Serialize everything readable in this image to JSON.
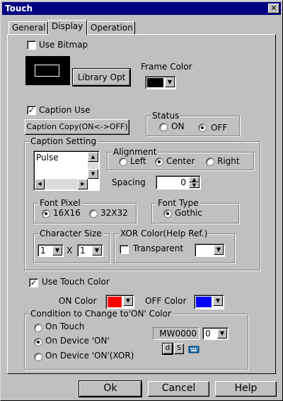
{
  "window": {
    "title": "Touch",
    "close_glyph": "✕"
  },
  "tabs": [
    {
      "label": "General",
      "active": false
    },
    {
      "label": "Display",
      "active": true
    },
    {
      "label": "Operation",
      "active": false
    }
  ],
  "bitmap": {
    "use_label": "Use Bitmap",
    "checked": false,
    "library_button": "Library Opt"
  },
  "frame_color": {
    "label": "Frame Color",
    "color": "#000000"
  },
  "caption": {
    "use_label": "Caption Use",
    "checked": true,
    "check_glyph": "✓",
    "copy_button": "Caption Copy(ON<->OFF)"
  },
  "status": {
    "title": "Status",
    "on_label": "ON",
    "off_label": "OFF",
    "selected": "OFF"
  },
  "caption_setting": {
    "title": "Caption Setting",
    "text_value": "Pulse",
    "alignment": {
      "title": "Alignment",
      "left": "Left",
      "center": "Center",
      "right": "Right",
      "selected": "Center"
    },
    "spacing": {
      "label": "Spacing",
      "value": "0"
    },
    "font_pixel": {
      "title": "Font Pixel",
      "opt1": "16X16",
      "opt2": "32X32",
      "selected": "16X16"
    },
    "font_type": {
      "title": "Font Type",
      "opt1": "Gothic",
      "selected": "Gothic"
    },
    "character_size": {
      "title": "Character Size",
      "width": "1",
      "height": "1",
      "x_label": "X"
    },
    "xor_color": {
      "title": "XOR Color(Help Ref.)",
      "transparent_label": "Transparent",
      "checked": false
    }
  },
  "touch_color": {
    "use_label": "Use Touch Color",
    "checked": true,
    "on_label": "ON Color",
    "on_color": "#ff0000",
    "off_label": "OFF Color",
    "off_color": "#0000ff"
  },
  "condition": {
    "title": "Condition to Change to'ON' Color",
    "opt1": "On Touch",
    "opt2": "On Device  'ON'",
    "opt3": "On Device  'ON'(XOR)",
    "selected": "On Device  'ON'",
    "device": "MW0000",
    "bit": "0",
    "d_button": "d",
    "s_button": "S"
  },
  "footer": {
    "ok": "Ok",
    "cancel": "Cancel",
    "help": "Help"
  },
  "colors": {
    "face": "#c0c0c0",
    "title_bar": "#000080",
    "shadow": "#808080",
    "highlight": "#ffffff"
  }
}
